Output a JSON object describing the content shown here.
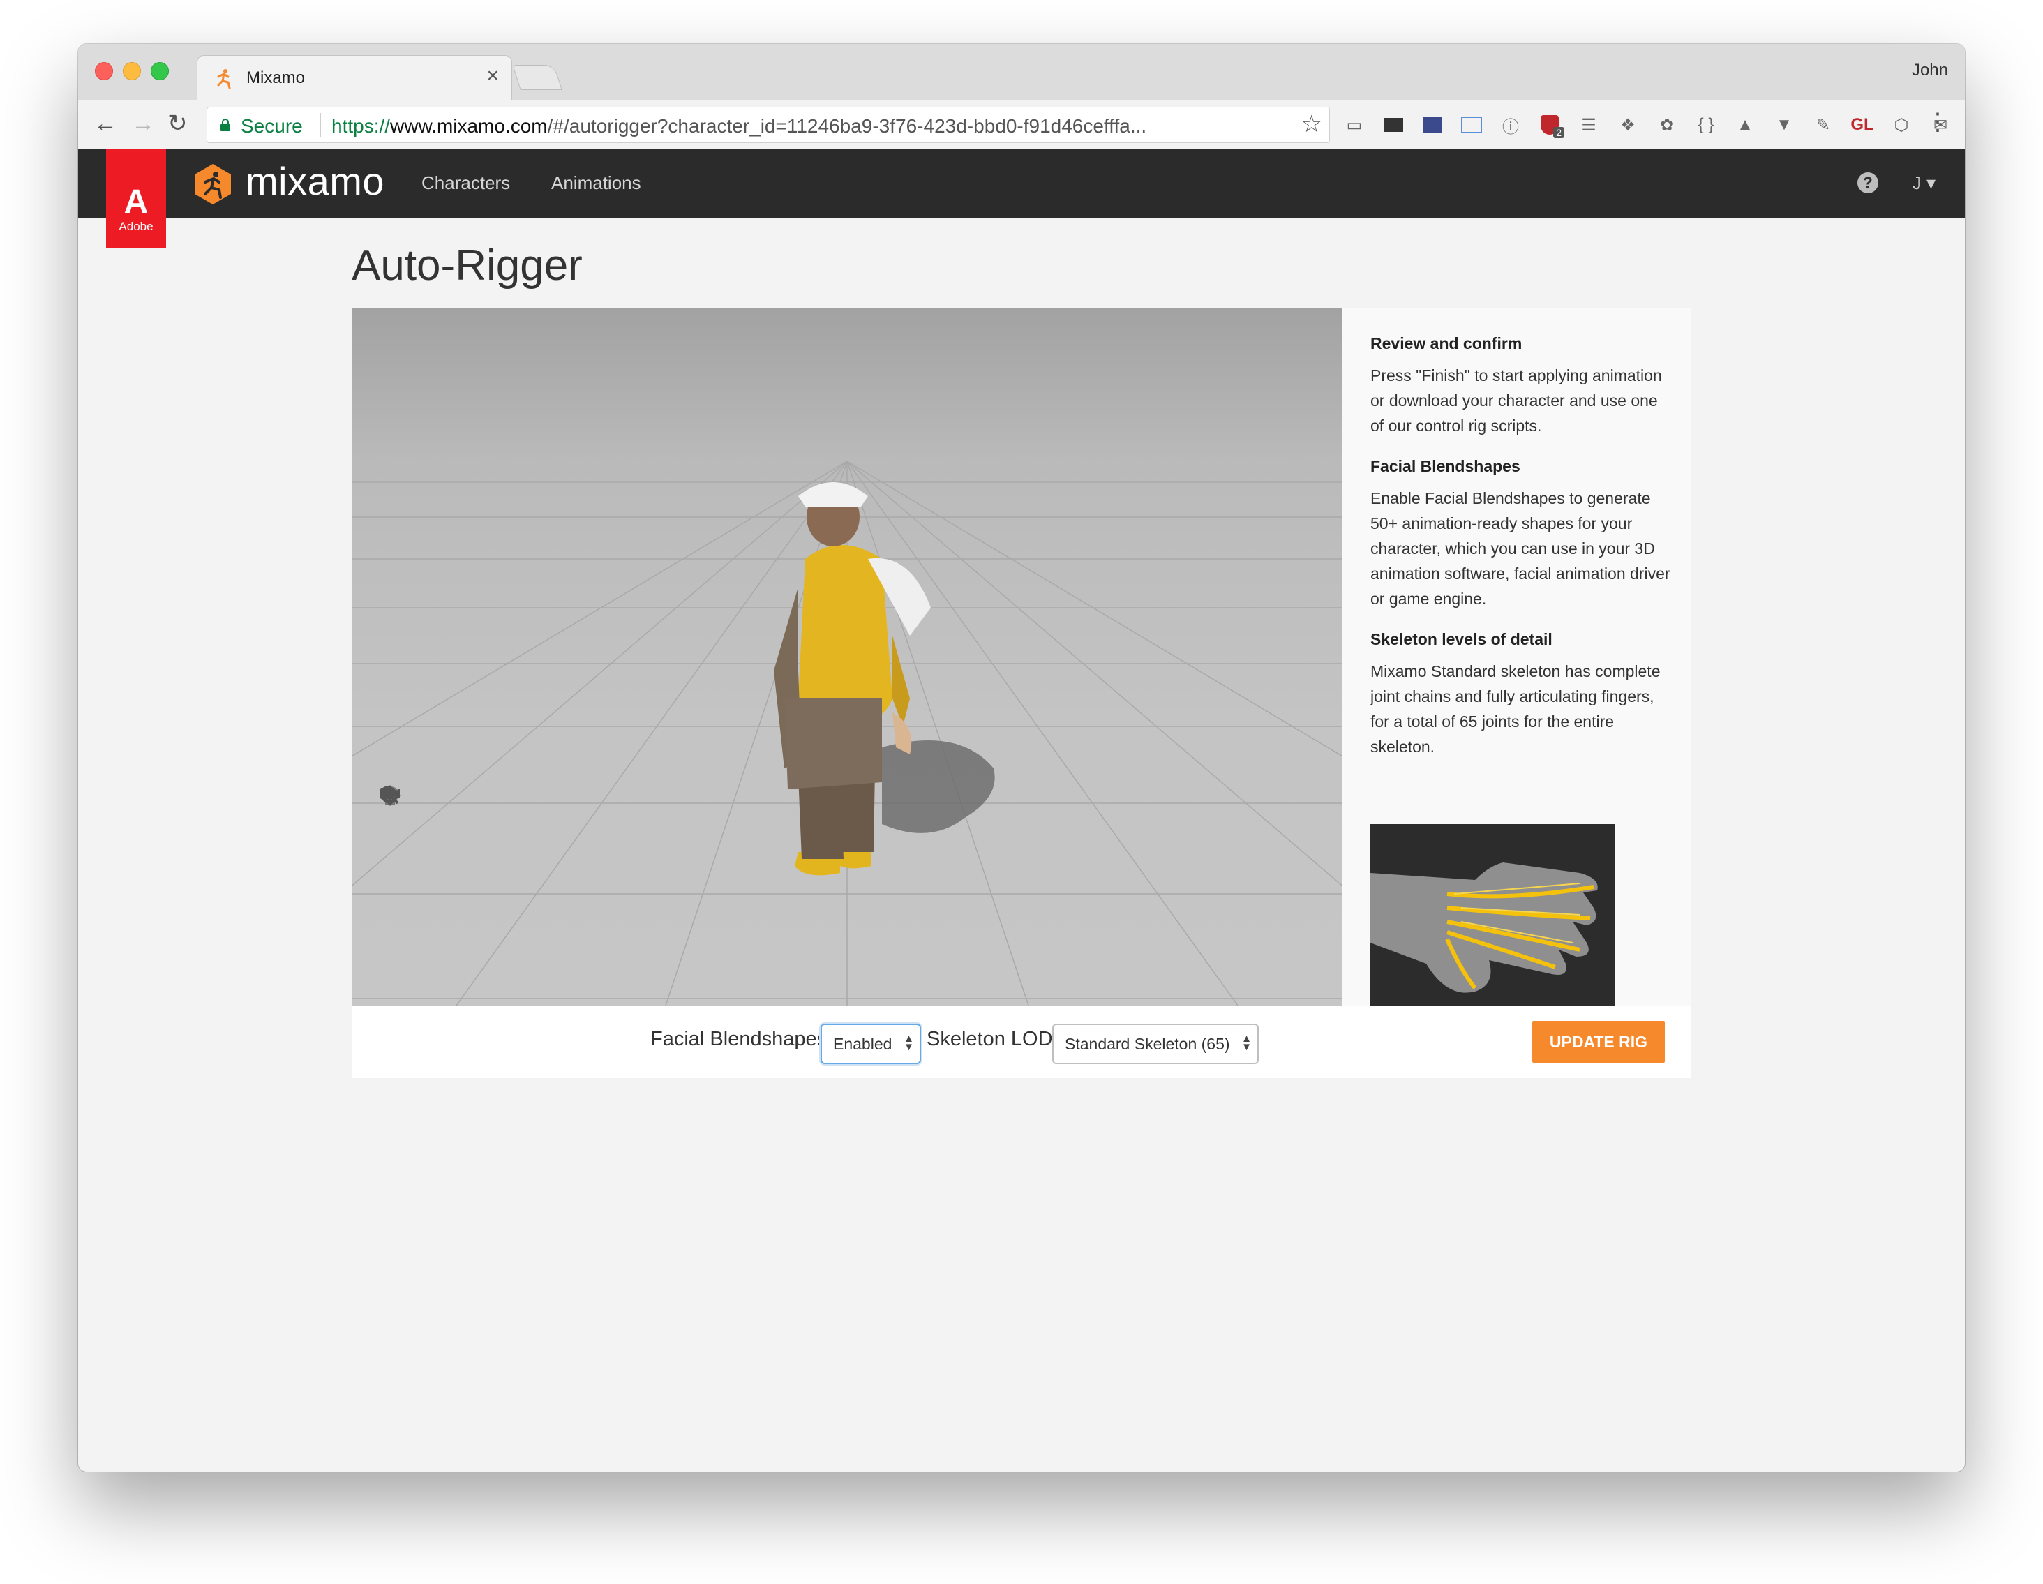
{
  "browser": {
    "tab_title": "Mixamo",
    "tab_close": "×",
    "profile_name": "John",
    "secure_label": "Secure",
    "url_scheme": "https://",
    "url_host": "www.mixamo.com",
    "url_path": "/#/autorigger?character_id=11246ba9-3f76-423d-bbd0-f91d46cefffa...",
    "extension_badge": "2",
    "extension_gl": "GL",
    "extension_braces": "{ }"
  },
  "site": {
    "adobe_wordmark": "Adobe",
    "brand": "mixamo",
    "nav": [
      "Characters",
      "Animations"
    ],
    "help": "?",
    "user_initial": "J"
  },
  "page": {
    "title": "Auto-Rigger"
  },
  "panel": {
    "sections": [
      {
        "heading": "Review and confirm",
        "text": "Press \"Finish\" to start applying animation or download your character and use one of our control rig scripts."
      },
      {
        "heading": "Facial Blendshapes",
        "text": "Enable Facial Blendshapes to generate 50+ animation-ready shapes for your character, which you can use in your 3D animation software, facial animation driver or game engine."
      },
      {
        "heading": "Skeleton levels of detail",
        "text": "Mixamo Standard skeleton has complete joint chains and fully articulating fingers, for a total of 65 joints for the entire skeleton."
      }
    ]
  },
  "controls": {
    "facial_label": "Facial Blendshapes",
    "facial_value": "Enabled",
    "skeleton_label": "Skeleton LOD",
    "skeleton_value": "Standard Skeleton (65)",
    "update_button": "UPDATE RIG"
  },
  "colors": {
    "accent": "#f7892d",
    "header_bg": "#2b2b2b",
    "adobe_red": "#ed1c24",
    "secure_green": "#0b8043"
  },
  "icons": {
    "viewer_tools": [
      "skull-icon",
      "reset-icon",
      "pan-icon",
      "zoom-icon",
      "power-icon",
      "camera-icon"
    ]
  }
}
